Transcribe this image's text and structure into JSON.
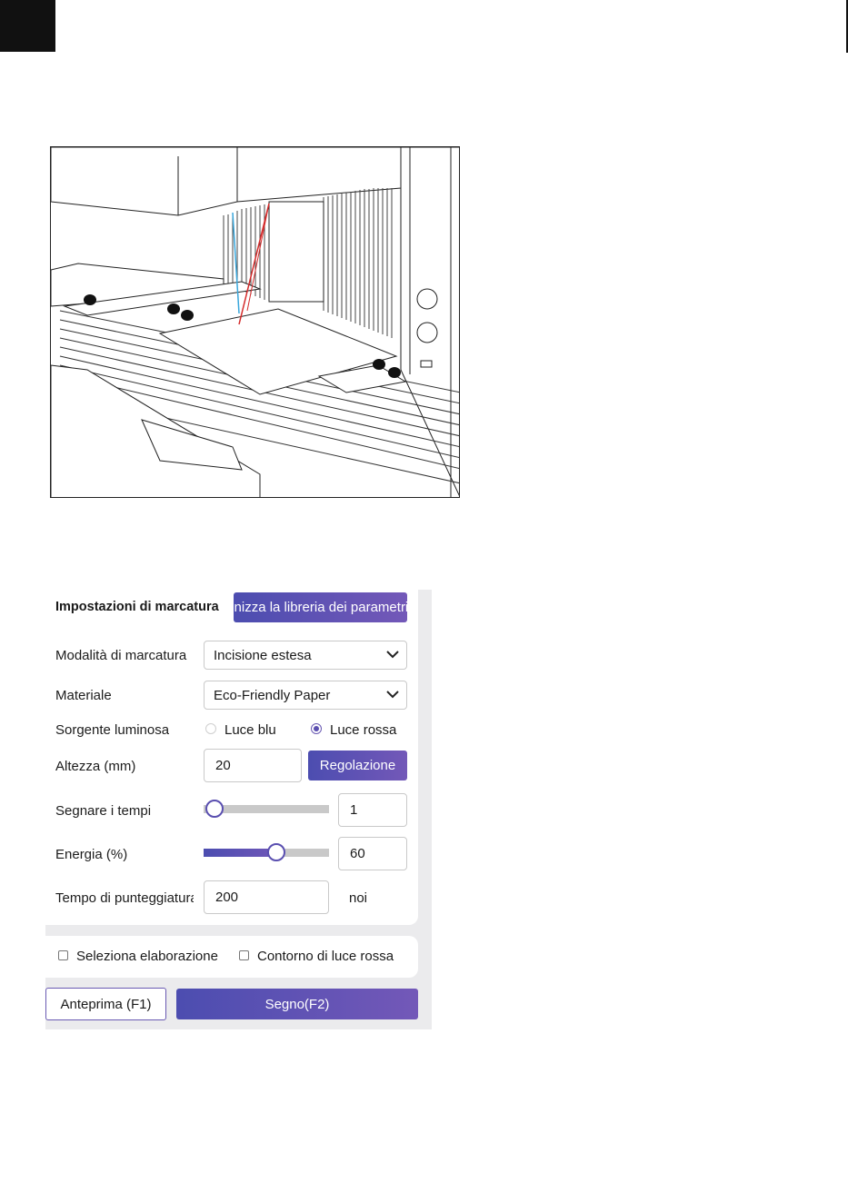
{
  "panel": {
    "title": "Impostazioni di marcatura",
    "library_button": "Sincronizza la libreria dei parametri",
    "marking_mode": {
      "label": "Modalità di marcatura",
      "value": "Incisione estesa"
    },
    "material": {
      "label": "Materiale",
      "value": "Eco-Friendly Paper"
    },
    "light_source": {
      "label": "Sorgente luminosa",
      "option_blue": "Luce blu",
      "option_red": "Luce rossa",
      "selected": "Luce rossa"
    },
    "height": {
      "label": "Altezza (mm)",
      "value": "20",
      "adjust_button": "Regolazione"
    },
    "mark_times": {
      "label": "Segnare i tempi",
      "value": "1",
      "level": 0.0
    },
    "energy": {
      "label": "Energia (%)",
      "value": "60",
      "level": 0.6
    },
    "dot_time": {
      "label": "Tempo di punteggiatura",
      "value": "200",
      "unit": "noi"
    },
    "select_processing": "Seleziona elaborazione",
    "red_light_outline": "Contorno di luce rossa",
    "preview_button": "Anteprima (F1)",
    "mark_button": "Segno(F2)"
  },
  "colors": {
    "accent_start": "#4c4db0",
    "accent_end": "#7358b8",
    "laser_blue": "#3aa7dc",
    "laser_red": "#d42a2a"
  },
  "icons": [
    "chevron-down-icon"
  ]
}
